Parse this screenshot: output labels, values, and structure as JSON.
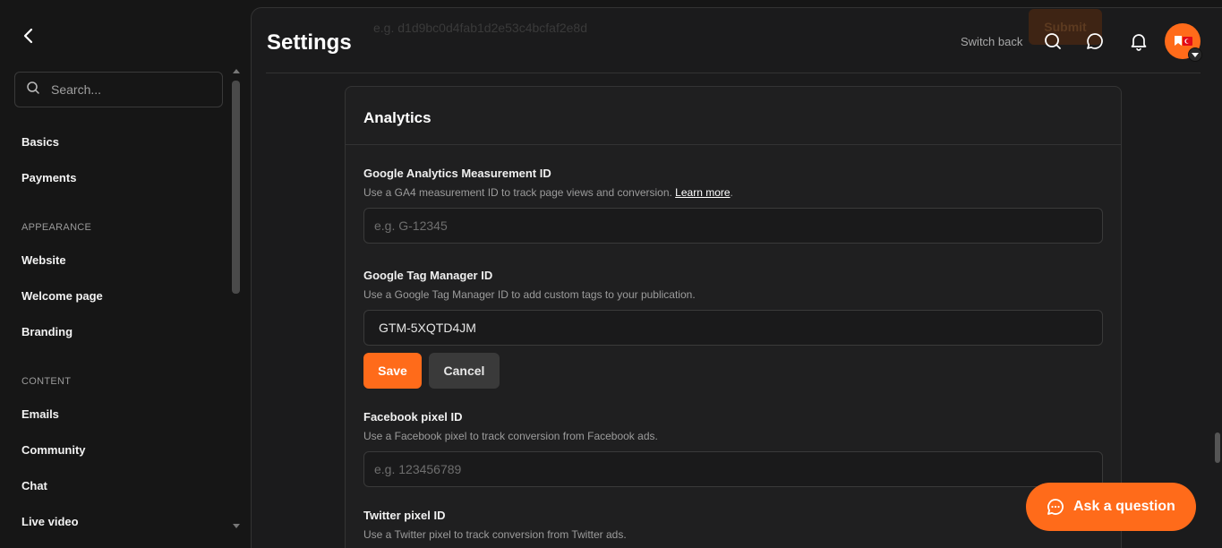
{
  "sidebar": {
    "search_placeholder": "Search...",
    "items_top": [
      "Basics",
      "Payments"
    ],
    "appearance_header": "APPEARANCE",
    "appearance_items": [
      "Website",
      "Welcome page",
      "Branding"
    ],
    "content_header": "CONTENT",
    "content_items": [
      "Emails",
      "Community",
      "Chat",
      "Live video"
    ]
  },
  "header": {
    "title": "Settings",
    "switch_back": "Switch back",
    "ghost_placeholder": "e.g. d1d9bc0d4fab1d2e53c4bcfaf2e8d",
    "ghost_button": "Submit"
  },
  "card": {
    "title": "Analytics",
    "fields": [
      {
        "label": "Google Analytics Measurement ID",
        "help": "Use a GA4 measurement ID to track page views and conversion. ",
        "help_link": "Learn more",
        "help_suffix": ".",
        "placeholder": "e.g. G-12345",
        "value": ""
      },
      {
        "label": "Google Tag Manager ID",
        "help": "Use a Google Tag Manager ID to add custom tags to your publication.",
        "placeholder": "",
        "value": "GTM-5XQTD4JM"
      },
      {
        "label": "Facebook pixel ID",
        "help": "Use a Facebook pixel to track conversion from Facebook ads.",
        "placeholder": "e.g. 123456789",
        "value": ""
      },
      {
        "label": "Twitter pixel ID",
        "help": "Use a Twitter pixel to track conversion from Twitter ads."
      }
    ],
    "save_label": "Save",
    "cancel_label": "Cancel"
  },
  "ask_button": "Ask a question",
  "colors": {
    "accent": "#ff6b1a",
    "background": "#161616",
    "panel": "#1f1f20"
  }
}
